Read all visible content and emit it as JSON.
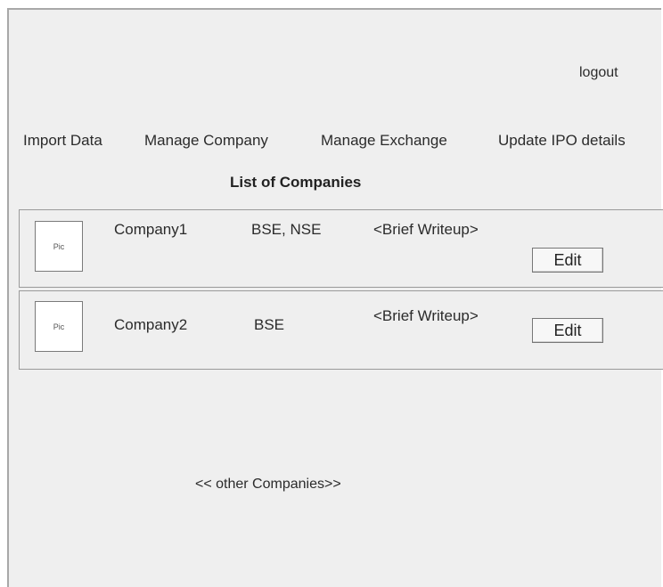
{
  "header": {
    "logout_label": "logout"
  },
  "nav": {
    "items": [
      {
        "label": "Import Data"
      },
      {
        "label": "Manage Company"
      },
      {
        "label": "Manage Exchange"
      },
      {
        "label": "Update IPO details"
      }
    ]
  },
  "main": {
    "heading": "List of Companies",
    "companies": [
      {
        "pic": "Pic",
        "name": "Company1",
        "exchanges": "BSE, NSE",
        "writeup": "<Brief Writeup>",
        "edit_label": "Edit"
      },
      {
        "pic": "Pic",
        "name": "Company2",
        "exchanges": "BSE",
        "writeup": "<Brief Writeup>",
        "edit_label": "Edit"
      }
    ],
    "other_companies_label": "<< other Companies>>"
  },
  "colors": {
    "background": "#efefef",
    "border": "#9a9a9a",
    "text": "#2b2b2b"
  }
}
